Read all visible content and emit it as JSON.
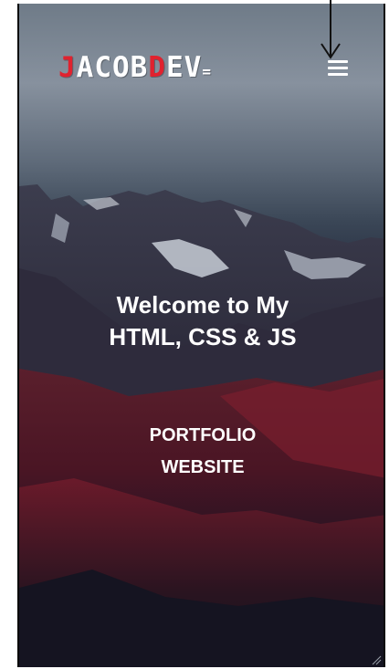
{
  "brand": {
    "logo_red_1": "J",
    "logo_white_1": "ACOB",
    "logo_red_2": "D",
    "logo_white_2": "EV",
    "logo_suffix": "="
  },
  "header": {
    "menu_icon": "hamburger-menu-icon"
  },
  "hero": {
    "title": "Welcome to My HTML, CSS & JS",
    "subtitle": "PORTFOLIO WEBSITE"
  },
  "colors": {
    "accent_red": "#e0222f",
    "text": "#ffffff"
  }
}
